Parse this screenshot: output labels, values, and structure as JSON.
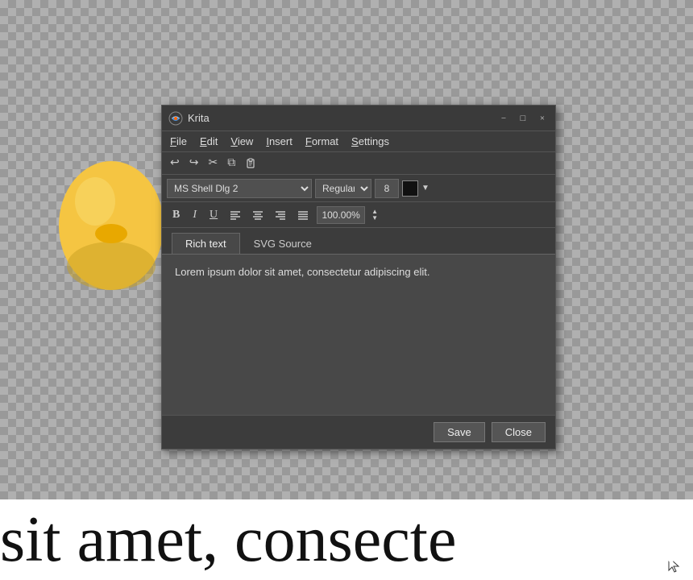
{
  "app": {
    "title": "Krita",
    "background": "#6b6b6b"
  },
  "titlebar": {
    "title": "Krita",
    "minimize_label": "−",
    "maximize_label": "□",
    "close_label": "×"
  },
  "menubar": {
    "items": [
      {
        "label": "File",
        "underline_index": 0
      },
      {
        "label": "Edit",
        "underline_index": 0
      },
      {
        "label": "View",
        "underline_index": 0
      },
      {
        "label": "Insert",
        "underline_index": 0
      },
      {
        "label": "Format",
        "underline_index": 0
      },
      {
        "label": "Settings",
        "underline_index": 0
      }
    ]
  },
  "toolbar1": {
    "undo_label": "↩",
    "redo_label": "↪",
    "cut_label": "✂",
    "copy_label": "⧉",
    "paste_label": "📋"
  },
  "toolbar2": {
    "font_name": "MS Shell Dlg 2",
    "font_style": "Regular",
    "font_size": "8",
    "color": "#111111"
  },
  "toolbar3": {
    "bold_label": "B",
    "italic_label": "I",
    "underline_label": "U",
    "align_left_label": "≡",
    "align_center_label": "≡",
    "align_right_label": "≡",
    "align_justify_label": "≡",
    "zoom_value": "100.00%"
  },
  "tabs": [
    {
      "label": "Rich text",
      "active": true
    },
    {
      "label": "SVG Source",
      "active": false
    }
  ],
  "content": {
    "text": "Lorem ipsum dolor sit amet, consectetur adipiscing elit."
  },
  "footer": {
    "save_label": "Save",
    "close_label": "Close"
  },
  "bottom_bar": {
    "text": " sit amet, consecte"
  }
}
